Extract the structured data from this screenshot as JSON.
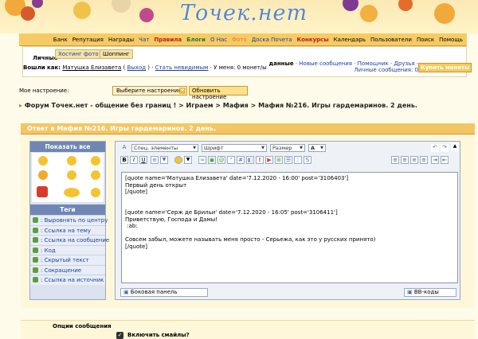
{
  "site": {
    "logo_text": "Точек.нет"
  },
  "nav": {
    "items": [
      "Банк",
      "Репутация",
      "Награды",
      "Чат",
      "Правила",
      "Блоги",
      "О Нас",
      "Фото",
      "Доска Почета",
      "Конкурсы",
      "Календарь",
      "Пользователи",
      "Поиск",
      "Помощь"
    ]
  },
  "subnav": {
    "tab_personal": "Личные",
    "tab_hosting": "Хостинг фото",
    "tab_shop": "Шоппинг",
    "login_prefix": "Вошли как:",
    "username": "Матушка Елизавета",
    "logout": "Выход",
    "invisible": "Стать невидимым",
    "coins": "У меня: 0 монет/ы",
    "links": [
      "данные",
      "Новые сообщения",
      "Помощник",
      "Друзья",
      "Личные сообщения: 0"
    ],
    "buy_coins": "Купить монеты"
  },
  "mood": {
    "label": "Мое настроение:",
    "select": "Выберите настроение",
    "button": "Обновить настроение"
  },
  "breadcrumb": "Форум Точек.нет - общение без границ ! > Играем > Мафия > Мафия №216. Игры гардемаринов. 2 день.",
  "panel": {
    "title": "Ответ в Мафия №216. Игры гардемаринов. 2 день."
  },
  "smilies": {
    "header": "Показать все"
  },
  "tags": {
    "header": "Теги",
    "items": [
      "Выровнять по центру",
      "Ссылка на тему",
      "Ссылка на сообщение",
      "Код",
      "Скрытый текст",
      "Сокращение",
      "Ссылка на источник"
    ]
  },
  "editor": {
    "elements": "Спец. элементы",
    "font": "Шрифт",
    "size": "Размер",
    "lines": [
      "[quote name='Матушка Елизавета' date='7.12.2020 - 16:00' post='3106403']",
      "Первый день открыт",
      "[/quote]",
      "",
      "",
      "[quote name='Серж де Брильи' date='7.12.2020 - 16:05' post='3106411']",
      "Приветствую, Господа и Дамы!",
      " :ab:",
      "",
      "Совсем забыл, можете называть меня просто - Серьежа, как это у русских принято)",
      "[/quote]"
    ],
    "side_panel": "Боковая панель",
    "bb_codes": "BB-коды"
  },
  "options": {
    "title": "Опции сообщения",
    "smilies": "Включить смайлы?"
  }
}
